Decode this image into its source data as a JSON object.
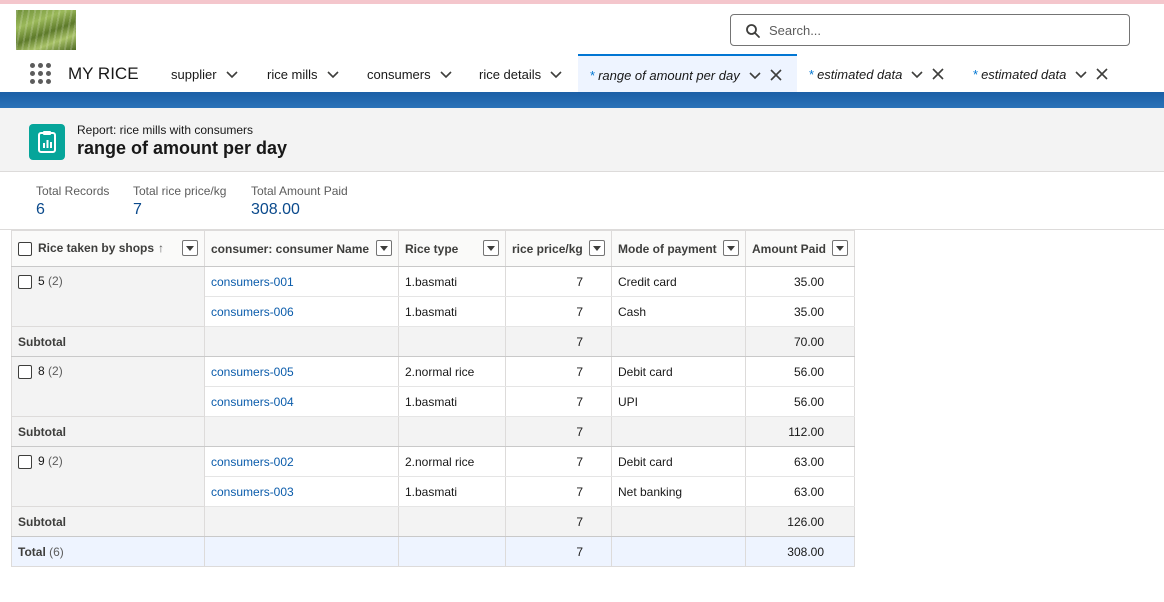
{
  "header": {
    "search_placeholder": "Search...",
    "app_name": "MY RICE"
  },
  "nav": {
    "tabs": [
      {
        "label": "supplier"
      },
      {
        "label": "rice mills"
      },
      {
        "label": "consumers"
      },
      {
        "label": "rice details"
      },
      {
        "label": "range of amount per day",
        "unsaved_marker": "*"
      },
      {
        "label": "estimated data",
        "unsaved_marker": "*"
      },
      {
        "label": "estimated data",
        "unsaved_marker": "*"
      }
    ]
  },
  "report": {
    "subtitle": "Report: rice mills with consumers",
    "title": "range of amount per day",
    "summary": [
      {
        "label": "Total Records",
        "value": "6"
      },
      {
        "label": "Total rice price/kg",
        "value": "7"
      },
      {
        "label": "Total Amount Paid",
        "value": "308.00"
      }
    ]
  },
  "table": {
    "columns": [
      {
        "label": "Rice taken by shops",
        "sort_arrow": "↑"
      },
      {
        "label": "consumer: consumer Name"
      },
      {
        "label": "Rice type"
      },
      {
        "label": "rice price/kg"
      },
      {
        "label": "Mode of payment"
      },
      {
        "label": "Amount Paid"
      }
    ],
    "groups": [
      {
        "value": "5",
        "count": "(2)",
        "rows": [
          {
            "name": "consumers-001",
            "rice_type": "1.basmati",
            "price": "7",
            "payment": "Credit card",
            "amount": "35.00"
          },
          {
            "name": "consumers-006",
            "rice_type": "1.basmati",
            "price": "7",
            "payment": "Cash",
            "amount": "35.00"
          }
        ],
        "subtotal_label": "Subtotal",
        "subtotal_price": "7",
        "subtotal_amount": "70.00"
      },
      {
        "value": "8",
        "count": "(2)",
        "rows": [
          {
            "name": "consumers-005",
            "rice_type": "2.normal rice",
            "price": "7",
            "payment": "Debit card",
            "amount": "56.00"
          },
          {
            "name": "consumers-004",
            "rice_type": "1.basmati",
            "price": "7",
            "payment": "UPI",
            "amount": "56.00"
          }
        ],
        "subtotal_label": "Subtotal",
        "subtotal_price": "7",
        "subtotal_amount": "112.00"
      },
      {
        "value": "9",
        "count": "(2)",
        "rows": [
          {
            "name": "consumers-002",
            "rice_type": "2.normal rice",
            "price": "7",
            "payment": "Debit card",
            "amount": "63.00"
          },
          {
            "name": "consumers-003",
            "rice_type": "1.basmati",
            "price": "7",
            "payment": "Net banking",
            "amount": "63.00"
          }
        ],
        "subtotal_label": "Subtotal",
        "subtotal_price": "7",
        "subtotal_amount": "126.00"
      }
    ],
    "total": {
      "label": "Total",
      "count": "(6)",
      "price": "7",
      "amount": "308.00"
    }
  },
  "colors": {
    "accent": "#0176d3",
    "link": "#0b5cab",
    "report_icon": "#06a59a"
  }
}
